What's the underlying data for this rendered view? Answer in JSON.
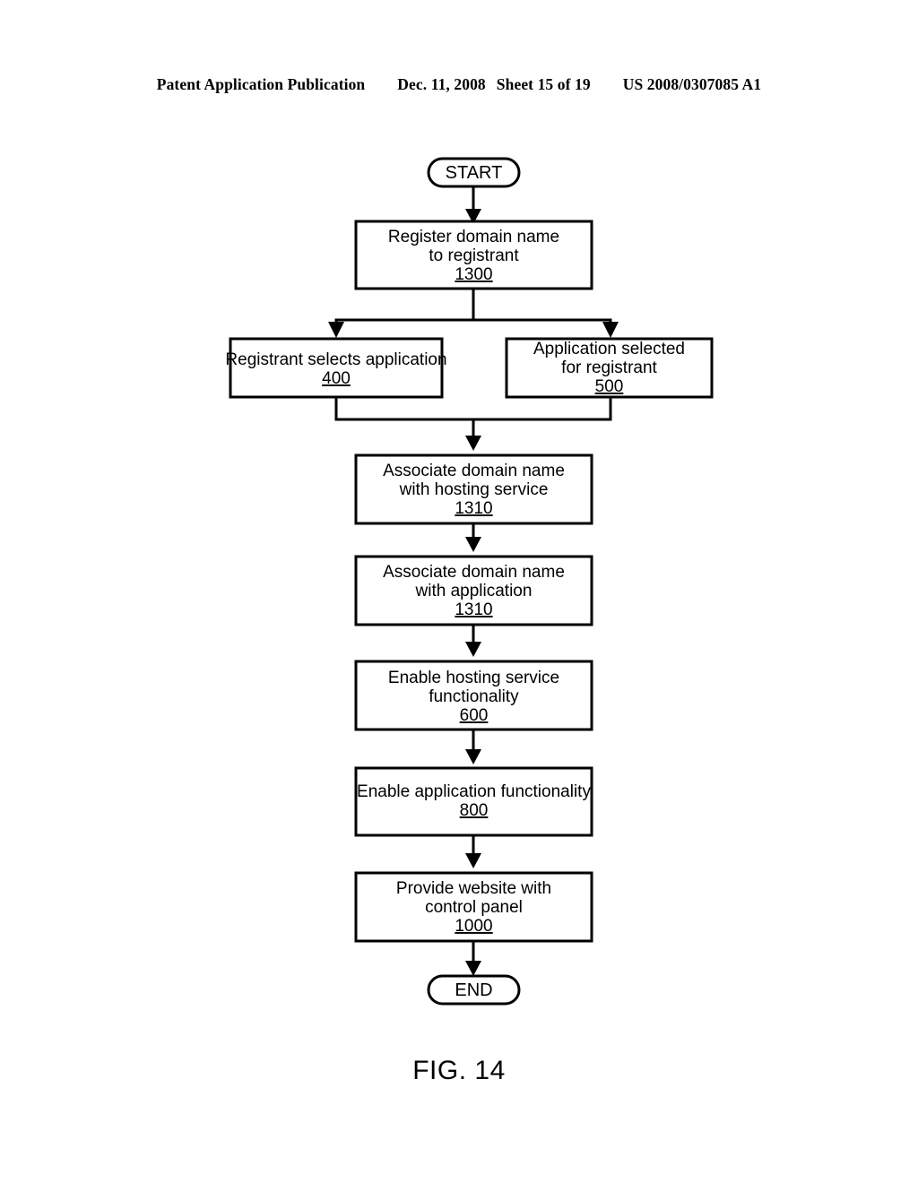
{
  "header": {
    "publication": "Patent Application Publication",
    "date": "Dec. 11, 2008",
    "sheet": "Sheet 15 of 19",
    "patent_number": "US 2008/0307085 A1"
  },
  "figure": {
    "caption": "FIG. 14"
  },
  "flowchart": {
    "start": {
      "label": "START"
    },
    "end": {
      "label": "END"
    },
    "nodes": [
      {
        "id": "register-domain-name",
        "line1": "Register domain name",
        "line2": "to registrant",
        "ref": "1300"
      },
      {
        "id": "registrant-selects-application",
        "line1": "Registrant selects application",
        "line2": "",
        "ref": "400"
      },
      {
        "id": "application-selected-for-registrant",
        "line1": "Application selected",
        "line2": "for registrant",
        "ref": "500"
      },
      {
        "id": "associate-domain-with-hosting-service",
        "line1": "Associate domain name",
        "line2": "with hosting service",
        "ref": "1310"
      },
      {
        "id": "associate-domain-with-application",
        "line1": "Associate domain name",
        "line2": "with application",
        "ref": "1310"
      },
      {
        "id": "enable-hosting-service-functionality",
        "line1": "Enable hosting service",
        "line2": "functionality",
        "ref": "600"
      },
      {
        "id": "enable-application-functionality",
        "line1": "Enable application functionality",
        "line2": "",
        "ref": "800"
      },
      {
        "id": "provide-website-with-control-panel",
        "line1": "Provide website with",
        "line2": "control panel",
        "ref": "1000"
      }
    ]
  },
  "colors": {
    "ink": "#000000",
    "paper": "#ffffff"
  }
}
